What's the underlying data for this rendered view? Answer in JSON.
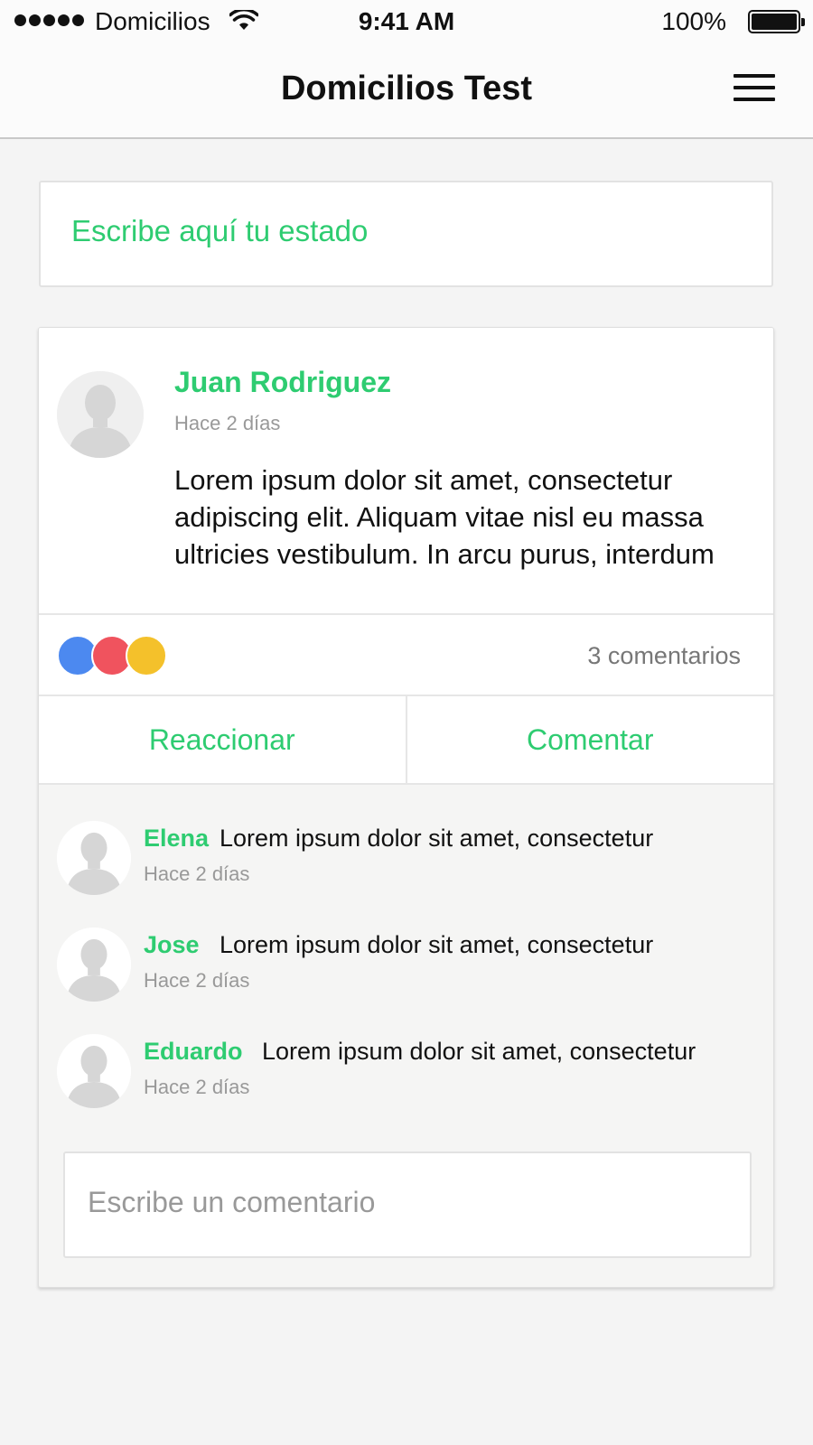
{
  "status_bar": {
    "carrier": "Domicilios",
    "time": "9:41 AM",
    "battery": "100%"
  },
  "header": {
    "title": "Domicilios Test",
    "menu_icon": "hamburger-menu-icon"
  },
  "composer": {
    "placeholder": "Escribe aquí tu estado"
  },
  "post": {
    "author": "Juan Rodriguez",
    "time": "Hace 2 días",
    "text": "Lorem ipsum dolor sit amet, consectetur adipiscing elit. Aliquam vitae nisl eu massa ultricies vestibulum. In arcu purus, interdum",
    "reactions": [
      "#4c89f0",
      "#f0535e",
      "#f4c12b"
    ],
    "comment_count": "3 comentarios",
    "actions": {
      "react": "Reaccionar",
      "comment": "Comentar"
    },
    "comments": [
      {
        "author": "Elena",
        "text": "Lorem ipsum dolor sit amet, consectetur",
        "time": "Hace 2 días"
      },
      {
        "author": "Jose",
        "text": "Lorem ipsum dolor sit amet, consectetur",
        "time": "Hace 2 días"
      },
      {
        "author": "Eduardo",
        "text": "Lorem ipsum dolor sit amet, consectetur",
        "time": "Hace 2 días"
      }
    ],
    "comment_placeholder": "Escribe un comentario"
  },
  "colors": {
    "accent": "#2ecc71",
    "muted": "#999999",
    "background": "#f4f4f4"
  }
}
